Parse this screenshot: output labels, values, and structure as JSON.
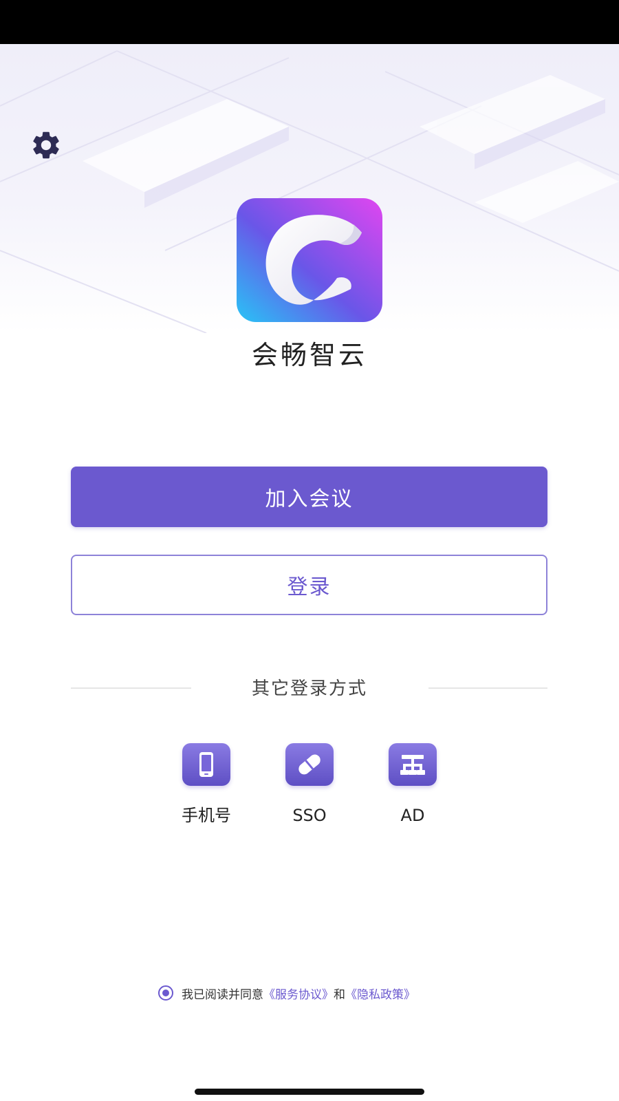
{
  "app": {
    "name": "会畅智云"
  },
  "buttons": {
    "join": "加入会议",
    "login": "登录"
  },
  "other_login": {
    "title": "其它登录方式",
    "methods": [
      {
        "label": "手机号",
        "icon": "phone-icon"
      },
      {
        "label": "SSO",
        "icon": "link-icon"
      },
      {
        "label": "AD",
        "icon": "network-icon"
      }
    ]
  },
  "agreement": {
    "prefix": "我已阅读并同意",
    "terms": "《服务协议》",
    "conjunction": "和",
    "privacy": "《隐私政策》",
    "checked": true
  },
  "colors": {
    "accent": "#6b59cf",
    "accent_light": "#8a7be3",
    "settings_icon": "#2d2b54"
  }
}
